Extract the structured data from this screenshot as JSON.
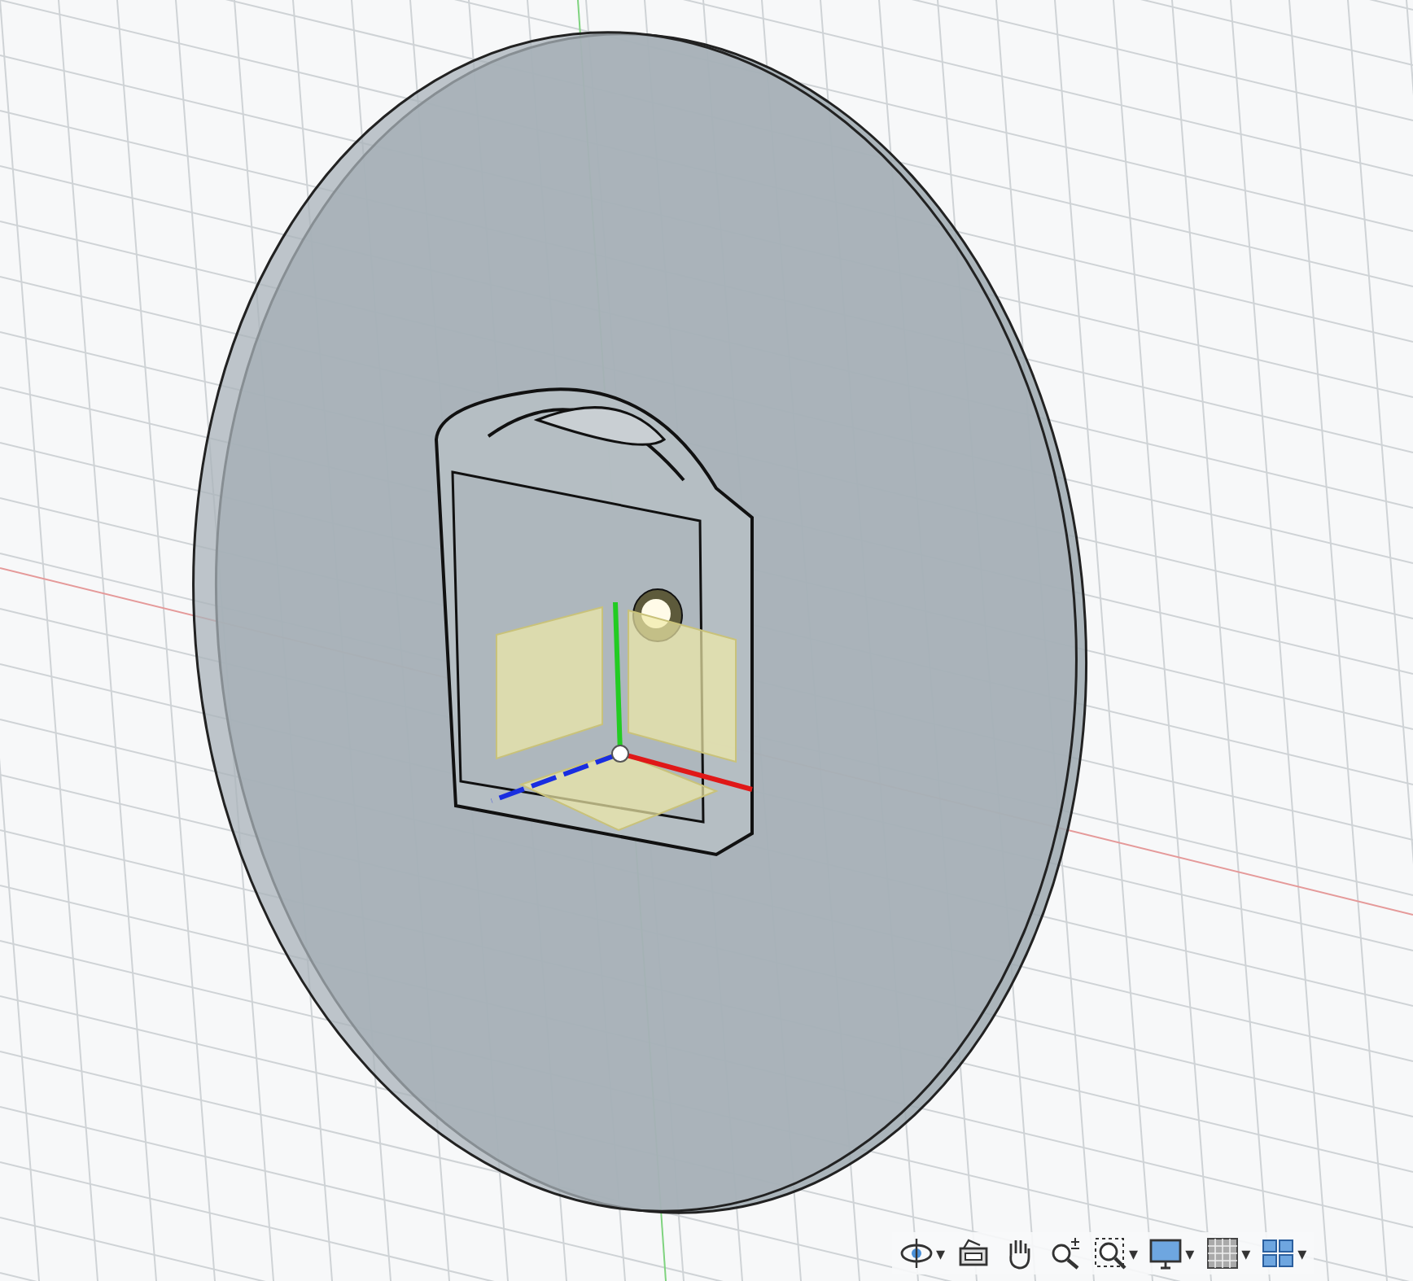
{
  "navigation_toolbar": {
    "tools": [
      {
        "kind": "orbit",
        "caret": "▾"
      },
      {
        "kind": "look_at"
      },
      {
        "kind": "pan"
      },
      {
        "kind": "zoom"
      },
      {
        "kind": "fit",
        "caret": "▾"
      },
      {
        "kind": "display",
        "caret": "▾"
      },
      {
        "kind": "grid",
        "caret": "▾"
      },
      {
        "kind": "viewports",
        "caret": "▾"
      }
    ]
  }
}
